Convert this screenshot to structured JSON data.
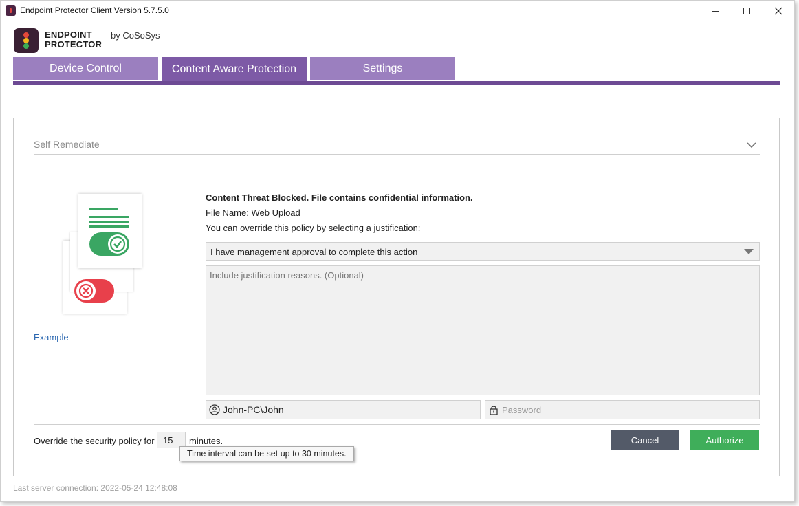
{
  "window": {
    "title": "Endpoint Protector Client Version 5.7.5.0"
  },
  "logo": {
    "line1": "ENDPOINT",
    "line2": "PROTECTOR",
    "by": "by CoSoSys"
  },
  "tabs": [
    {
      "label": "Device Control",
      "active": false
    },
    {
      "label": "Content Aware Protection",
      "active": true
    },
    {
      "label": "Settings",
      "active": false
    }
  ],
  "section": {
    "title": "Self Remediate"
  },
  "illustration": {
    "example_link": "Example"
  },
  "message": {
    "title": "Content Threat Blocked. File contains confidential information.",
    "file_name": "File Name: Web Upload",
    "override_hint": "You can override this policy by selecting a justification:"
  },
  "justification": {
    "selected": "I have management approval to complete this action",
    "reasons_placeholder": "Include justification reasons. (Optional)"
  },
  "credentials": {
    "username": "John-PC\\John",
    "password_placeholder": "Password"
  },
  "override": {
    "label": "Override the security policy for",
    "minutes_value": "15",
    "minutes_suffix": "minutes.",
    "tooltip": "Time interval can be set up to 30 minutes."
  },
  "buttons": {
    "cancel": "Cancel",
    "authorize": "Authorize"
  },
  "status": {
    "last_connection": "Last server connection: 2022-05-24 12:48:08"
  },
  "colors": {
    "tab": "#9b7fbf",
    "tab_active": "#7d5aa6",
    "tab_bar": "#6d4a94",
    "authorize": "#3fae5a",
    "cancel": "#535a68",
    "link": "#2a67b0"
  }
}
